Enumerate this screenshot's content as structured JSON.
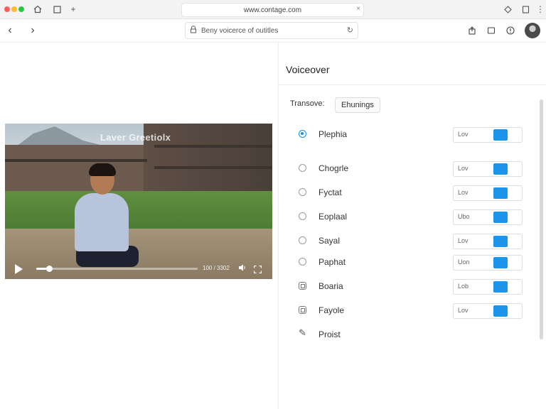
{
  "browser": {
    "url": "www.contage.com",
    "search_text": "Beny voicerce of outitles"
  },
  "panel": {
    "title": "Voiceover",
    "translate_label": "Transove:",
    "translate_button": "Ehunings"
  },
  "video": {
    "overlay_title": "Laver Greetiolx",
    "time": "100 / 3302",
    "progress": 0.08
  },
  "voices": [
    {
      "name": "Plephia",
      "icon": "radio-selected",
      "level_label": "Lov",
      "level": 0.62
    },
    {
      "name": "Chogrle",
      "icon": "radio",
      "level_label": "Lov",
      "level": 0.62
    },
    {
      "name": "Fyctat",
      "icon": "radio",
      "level_label": "Lov",
      "level": 0.62
    },
    {
      "name": "Eoplaal",
      "icon": "radio",
      "level_label": "Ubo",
      "level": 0.62
    },
    {
      "name": "Sayal",
      "icon": "radio",
      "level_label": "Lov",
      "level": 0.62
    },
    {
      "name": "Paphat",
      "icon": "radio",
      "level_label": "Uon",
      "level": 0.62
    },
    {
      "name": "Boaria",
      "icon": "box",
      "level_label": "Lob",
      "level": 0.62
    },
    {
      "name": "Fayole",
      "icon": "box",
      "level_label": "Lov",
      "level": 0.62
    },
    {
      "name": "Proist",
      "icon": "pencil",
      "level_label": "",
      "level": null
    }
  ],
  "colors": {
    "accent": "#1a95ea"
  }
}
